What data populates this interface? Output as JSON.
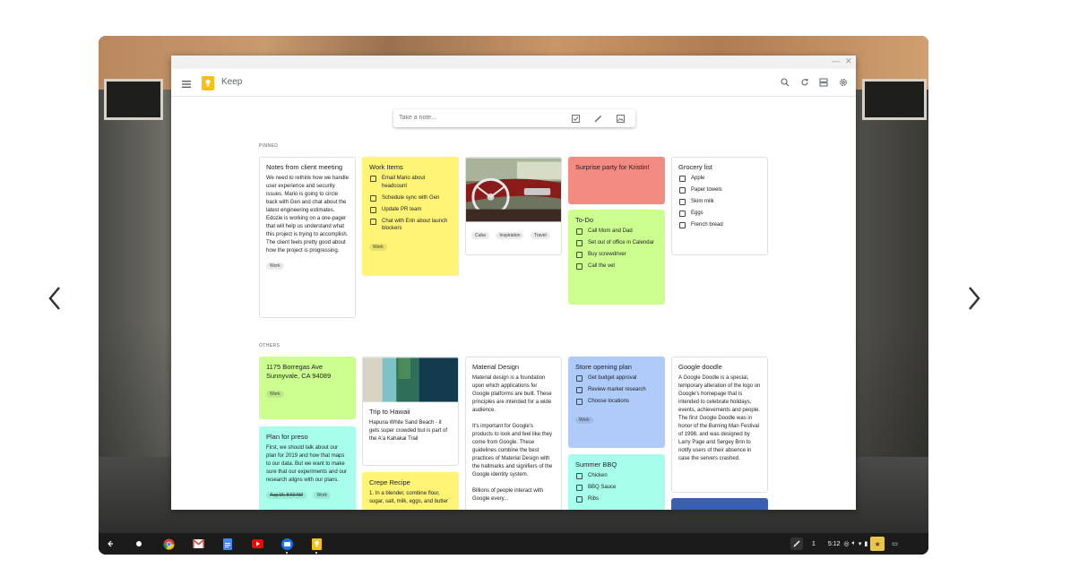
{
  "window": {
    "minimize": "—",
    "close": "✕"
  },
  "app": {
    "name": "Keep"
  },
  "take_note": {
    "placeholder": "Take a note..."
  },
  "sections": {
    "pinned": "PINNED",
    "others": "OTHERS"
  },
  "notes": {
    "client_meeting": {
      "title": "Notes from client meeting",
      "body": "We need to rethink how we handle user experience and security issues. Mario is going to circle back with Gen and chat about the latest engineering estimates. Edozie is working on a one-pager that will help us understand what this project is trying to accomplish. The client feels pretty good about how the project is progressing.",
      "label": "Work"
    },
    "work_items": {
      "title": "Work Items",
      "items": [
        "Email Mario about headcount",
        "Schedule sync with Gen",
        "Update PR team",
        "Chat with Erin about launch blockers"
      ],
      "label": "Work"
    },
    "car_photo": {
      "labels": [
        "Cuba",
        "Inspiration",
        "Travel"
      ]
    },
    "surprise_party": {
      "title": "Surprise party for Kristin!"
    },
    "todo": {
      "title": "To-Do",
      "items": [
        "Call Mom and Dad",
        "Set out of office in Calendar",
        "Buy screwdriver",
        "Call the vet"
      ]
    },
    "grocery": {
      "title": "Grocery list",
      "items": [
        "Apple",
        "Paper towels",
        "Skim milk",
        "Eggs",
        "French bread"
      ]
    },
    "address": {
      "title": "1175 Borregas Ave Sunnyvale, CA 94089",
      "label": "Work"
    },
    "plan_preso": {
      "title": "Plan for preso",
      "body": "First, we should talk about our plan for 2019 and how that maps to our data. But we want to make sure that our experiments and our research aligns with our plans.",
      "reminder": "Aug 15, 8:00 AM",
      "label": "Work"
    },
    "hawaii": {
      "title": "Trip to Hawaii",
      "body": "Hapuna White Sand Beach - it gets super crowded but is part of the A'a Kahakai Trail"
    },
    "crepe": {
      "title": "Crepe Recipe",
      "body": "1. In a blender, combine flour, sugar, salt, milk, eggs, and butter"
    },
    "material_design": {
      "title": "Material Design",
      "body": "Material design is a foundation upon which applications for Google platforms are built. These principles are intended for a wide audience.\n\nIt's important for Google's products to look and feel like they come from Google. These guidelines combine the best practices of Material Design with the hallmarks and signifiers of the Google identity system.\n\nBillions of people interact with Google every..."
    },
    "store_opening": {
      "title": "Store opening plan",
      "items": [
        "Get budget approval",
        "Review market research",
        "Choose locations"
      ],
      "label": "Work"
    },
    "summer_bbq": {
      "title": "Summer BBQ",
      "items": [
        "Chicken",
        "BBQ Sauce",
        "Ribs"
      ]
    },
    "google_doodle": {
      "title": "Google doodle",
      "body": "A Google Doodle is a special, temporary alteration of the logo on Google's homepage that is intended to celebrate holidays, events, achievements and people. The first Google Doodle was in honor of the Burning Man Festival of 1998, and was designed by Larry Page and Sergey Brin to notify users of their absence in case the servers crashed."
    }
  },
  "shelf": {
    "notification_count": "1",
    "time": "5:12"
  },
  "colors": {
    "yellow": "#fff475",
    "red": "#f28b82",
    "green": "#ccff90",
    "teal": "#a7ffeb",
    "blue": "#aecbfa",
    "keep_brand": "#f9c014"
  }
}
